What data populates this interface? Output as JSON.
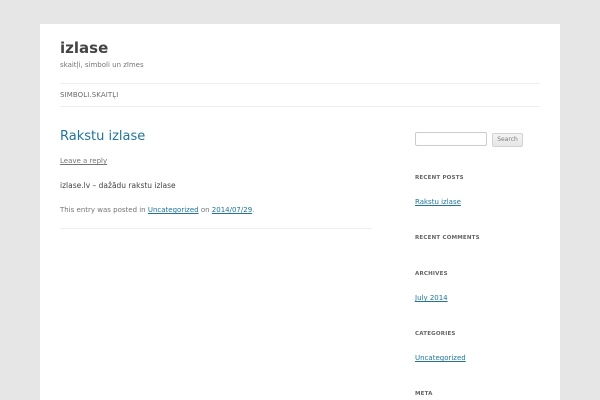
{
  "site": {
    "title": "izlase",
    "description": "skaitļi, simboli un zīmes"
  },
  "nav": {
    "items": [
      "SIMBOLI.SKAITĻI"
    ]
  },
  "post": {
    "title": "Rakstu izlase",
    "reply_label": "Leave a reply",
    "content": "izlase.lv – dažādu rakstu izlase",
    "meta_prefix": "This entry was posted in",
    "category": "Uncategorized",
    "meta_on": "on",
    "date": "2014/07/29",
    "meta_suffix": "."
  },
  "sidebar": {
    "search": {
      "value": "",
      "button_label": "Search"
    },
    "recent_posts": {
      "title": "RECENT POSTS",
      "items": [
        "Rakstu izlase"
      ]
    },
    "recent_comments": {
      "title": "RECENT COMMENTS"
    },
    "archives": {
      "title": "ARCHIVES",
      "items": [
        "July 2014"
      ]
    },
    "categories": {
      "title": "CATEGORIES",
      "items": [
        "Uncategorized"
      ]
    },
    "meta": {
      "title": "META"
    }
  },
  "colors": {
    "background": "#e6e6e6",
    "page": "#ffffff",
    "link": "#21759b",
    "text": "#444444"
  }
}
